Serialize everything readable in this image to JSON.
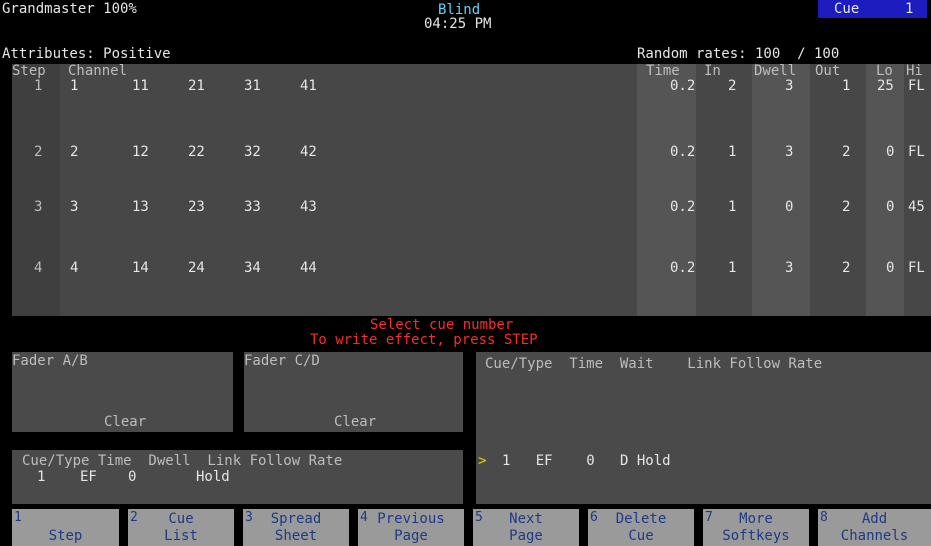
{
  "header": {
    "grandmaster": "Grandmaster 100%",
    "mode": "Blind",
    "clock": "04:25 PM",
    "cue_label": "Cue",
    "cue_number": "1",
    "attributes": "Attributes: Positive",
    "random_rates": "Random rates: 100  / 100"
  },
  "steps_table": {
    "headers": {
      "step": "Step",
      "channel": "Channel",
      "time": "Time",
      "in": "In",
      "dwell": "Dwell",
      "out": "Out",
      "lo": "Lo",
      "hi": "Hi"
    },
    "rows": [
      {
        "step": "1",
        "channels": [
          "1",
          "11",
          "21",
          "31",
          "41"
        ],
        "time": "0.2",
        "in": "2",
        "dwell": "3",
        "out": "1",
        "lo": "25",
        "hi": "FL"
      },
      {
        "step": "2",
        "channels": [
          "2",
          "12",
          "22",
          "32",
          "42"
        ],
        "time": "0.2",
        "in": "1",
        "dwell": "3",
        "out": "2",
        "lo": "0",
        "hi": "FL"
      },
      {
        "step": "3",
        "channels": [
          "3",
          "13",
          "23",
          "33",
          "43"
        ],
        "time": "0.2",
        "in": "1",
        "dwell": "0",
        "out": "2",
        "lo": "0",
        "hi": "45"
      },
      {
        "step": "4",
        "channels": [
          "4",
          "14",
          "24",
          "34",
          "44"
        ],
        "time": "0.2",
        "in": "1",
        "dwell": "3",
        "out": "2",
        "lo": "0",
        "hi": "FL"
      }
    ]
  },
  "prompt": {
    "line1": "Select cue number",
    "line2": "To write effect, press STEP"
  },
  "faders": {
    "ab_label": "Fader A/B",
    "ab_status": "Clear",
    "cd_label": "Fader C/D",
    "cd_status": "Clear"
  },
  "cue_list_panel": {
    "header": "Cue/Type  Time  Wait    Link Follow Rate",
    "marker": ">",
    "row": "1   EF    0   D Hold"
  },
  "current_cue": {
    "header": "Cue/Type Time  Dwell  Link Follow Rate",
    "cue": "1",
    "type": "EF",
    "time": "0",
    "dwell": "Hold"
  },
  "softkeys": [
    {
      "num": "1",
      "l1": "",
      "l2": "Step"
    },
    {
      "num": "2",
      "l1": "Cue",
      "l2": "List"
    },
    {
      "num": "3",
      "l1": "Spread",
      "l2": "Sheet"
    },
    {
      "num": "4",
      "l1": "Previous",
      "l2": "Page"
    },
    {
      "num": "5",
      "l1": "Next",
      "l2": "Page"
    },
    {
      "num": "6",
      "l1": "Delete",
      "l2": "Cue"
    },
    {
      "num": "7",
      "l1": "More",
      "l2": "Softkeys"
    },
    {
      "num": "8",
      "l1": "Add",
      "l2": "Channels"
    }
  ],
  "colors": {
    "mode": "#5fd3ff",
    "cue_box": "#1d1dbf",
    "prompt": "#ff2a2a",
    "marker": "#e8d400",
    "softkey_text": "#1d3a86"
  }
}
